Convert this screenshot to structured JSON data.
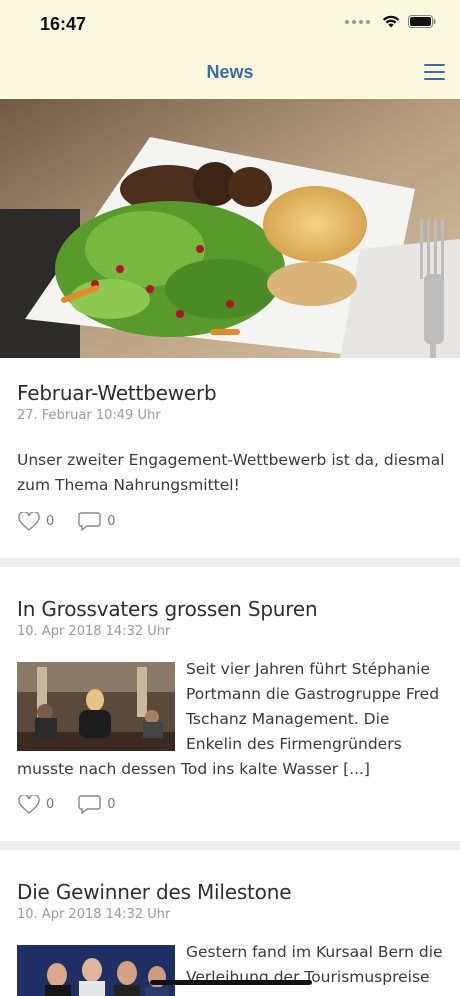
{
  "status": {
    "time": "16:47"
  },
  "nav": {
    "title": "News"
  },
  "articles": [
    {
      "title": "Februar-Wettbewerb",
      "date": "27. Februar 10:49 Uhr",
      "text": "Unser zweiter Engagement-Wettbewerb ist da, diesmal zum Thema Nahrungsmittel!",
      "likes": "0",
      "comments": "0"
    },
    {
      "title": "In Grossvaters grossen Spuren",
      "date": "10. Apr 2018 14:32 Uhr",
      "text_side": "Seit vier Jahren führt Stéphanie Portmann die Gastrogruppe Fred Tschanz Management. Die Enkelin des Firmengründers",
      "text_after": "musste nach dessen Tod ins kalte Wasser [...]",
      "likes": "0",
      "comments": "0"
    },
    {
      "title": "Die Gewinner des Milestone",
      "date": "10. Apr 2018 14:32 Uhr",
      "text_side": "Gestern fand im Kursaal Bern die Verleihung der Tourismuspreise"
    }
  ]
}
